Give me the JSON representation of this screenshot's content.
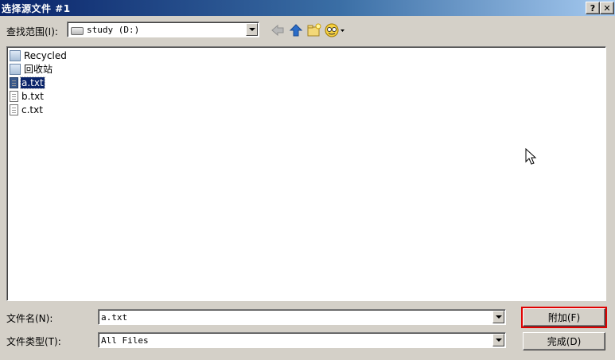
{
  "window": {
    "title": "选择源文件 #1",
    "help_label": "?",
    "close_label": "✕"
  },
  "lookin": {
    "label": "查找范围(I):",
    "value": "study (D:)"
  },
  "files": [
    {
      "name": "Recycled",
      "type": "folder",
      "selected": false
    },
    {
      "name": "回收站",
      "type": "folder",
      "selected": false
    },
    {
      "name": "a.txt",
      "type": "file",
      "selected": true
    },
    {
      "name": "b.txt",
      "type": "file",
      "selected": false
    },
    {
      "name": "c.txt",
      "type": "file",
      "selected": false
    }
  ],
  "filename": {
    "label": "文件名(N):",
    "value": "a.txt"
  },
  "filetype": {
    "label": "文件类型(T):",
    "value": "All Files"
  },
  "buttons": {
    "attach": "附加(F)",
    "done": "完成(D)"
  },
  "colors": {
    "titlebar": "#0a246a",
    "selection": "#0a246a",
    "highlight_border": "#e00000"
  }
}
